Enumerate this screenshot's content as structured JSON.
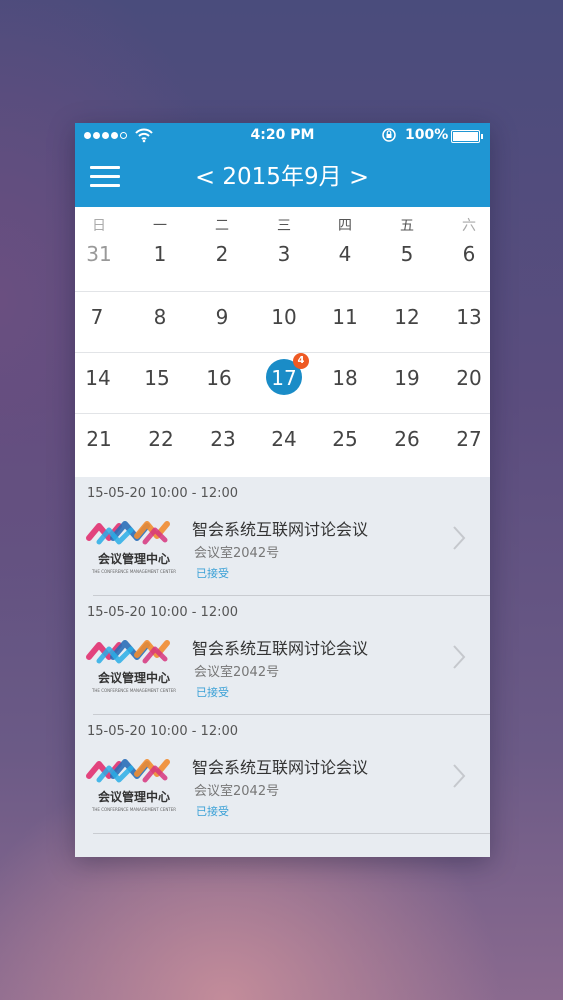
{
  "status_bar": {
    "time": "4:20 PM",
    "battery": "100%"
  },
  "nav": {
    "month_title": "2015年9月",
    "prev": "<",
    "next": ">"
  },
  "calendar": {
    "weekdays": [
      "日",
      "一",
      "二",
      "三",
      "四",
      "五",
      "六"
    ],
    "weeks": [
      [
        "31",
        "1",
        "2",
        "3",
        "4",
        "5",
        "6"
      ],
      [
        "7",
        "8",
        "9",
        "10",
        "11",
        "12",
        "13"
      ],
      [
        "14",
        "15",
        "16",
        "17",
        "18",
        "19",
        "20"
      ],
      [
        "21",
        "22",
        "23",
        "24",
        "25",
        "26",
        "27"
      ]
    ],
    "selected_day": "17",
    "selected_badge": "4"
  },
  "logo": {
    "cn": "会议管理中心",
    "en": "THE CONFERENCE MANAGEMENT CENTER"
  },
  "meetings": [
    {
      "time": "15-05-20 10:00 - 12:00",
      "title": "智会系统互联网讨论会议",
      "room": "会议室2042号",
      "status": "已接受"
    },
    {
      "time": "15-05-20 10:00 - 12:00",
      "title": "智会系统互联网讨论会议",
      "room": "会议室2042号",
      "status": "已接受"
    },
    {
      "time": "15-05-20 10:00 - 12:00",
      "title": "智会系统互联网讨论会议",
      "room": "会议室2042号",
      "status": "已接受"
    }
  ],
  "colors": {
    "primary": "#1f96d3",
    "selected": "#1a8cc7",
    "badge": "#ee5a24",
    "status": "#3aa0d6"
  }
}
